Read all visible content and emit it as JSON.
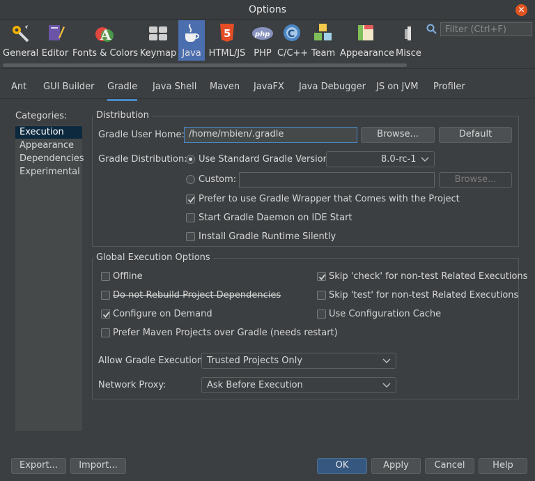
{
  "window": {
    "title": "Options"
  },
  "toolbar": {
    "items": [
      {
        "label": "General",
        "icon": "general-icon"
      },
      {
        "label": "Editor",
        "icon": "editor-icon"
      },
      {
        "label": "Fonts & Colors",
        "icon": "fonts-colors-icon"
      },
      {
        "label": "Keymap",
        "icon": "keymap-icon"
      },
      {
        "label": "Java",
        "icon": "java-icon",
        "selected": true
      },
      {
        "label": "HTML/JS",
        "icon": "html5-icon"
      },
      {
        "label": "PHP",
        "icon": "php-icon"
      },
      {
        "label": "C/C++",
        "icon": "cpp-icon"
      },
      {
        "label": "Team",
        "icon": "team-icon"
      },
      {
        "label": "Appearance",
        "icon": "appearance-icon"
      },
      {
        "label": "Miscel",
        "icon": "miscellaneous-icon"
      }
    ],
    "filter_placeholder": "Filter (Ctrl+F)"
  },
  "tabs": [
    "Ant",
    "GUI Builder",
    "Gradle",
    "Java Shell",
    "Maven",
    "JavaFX",
    "Java Debugger",
    "JS on JVM",
    "Profiler"
  ],
  "selected_tab": "Gradle",
  "categories": {
    "label": "Categories:",
    "items": [
      "Execution",
      "Appearance",
      "Dependencies",
      "Experimental"
    ],
    "selected": "Execution"
  },
  "distribution": {
    "legend": "Distribution",
    "user_home_label": "Gradle User Home:",
    "user_home_value": "/home/mbien/.gradle",
    "browse_label": "Browse...",
    "default_label": "Default",
    "distribution_label": "Gradle Distribution:",
    "standard_label": "Use Standard Gradle Version:",
    "standard_version": "8.0-rc-1",
    "custom_label": "Custom:",
    "custom_value": "",
    "custom_browse_label": "Browse...",
    "wrapper_label": "Prefer to use Gradle Wrapper that Comes with the Project",
    "wrapper_checked": true,
    "daemon_label": "Start Gradle Daemon on IDE Start",
    "daemon_checked": false,
    "silent_label": "Install Gradle Runtime Silently",
    "silent_checked": false
  },
  "global": {
    "legend": "Global Execution Options",
    "offline_label": "Offline",
    "offline_checked": false,
    "no_rebuild_label": "Do not Rebuild Project Dependencies",
    "no_rebuild_checked": false,
    "configure_label": "Configure on Demand",
    "configure_checked": true,
    "prefer_maven_label": "Prefer Maven Projects over Gradle (needs restart)",
    "prefer_maven_checked": false,
    "skip_check_label": "Skip 'check' for non-test Related Executions",
    "skip_check_checked": true,
    "skip_test_label": "Skip 'test' for non-test Related Executions",
    "skip_test_checked": false,
    "config_cache_label": "Use Configuration Cache",
    "config_cache_checked": false,
    "allow_exec_label": "Allow Gradle Execution:",
    "allow_exec_value": "Trusted Projects Only",
    "proxy_label": "Network Proxy:",
    "proxy_value": "Ask Before Execution"
  },
  "footer": {
    "export_label": "Export...",
    "import_label": "Import...",
    "ok_label": "OK",
    "apply_label": "Apply",
    "cancel_label": "Cancel",
    "help_label": "Help"
  }
}
